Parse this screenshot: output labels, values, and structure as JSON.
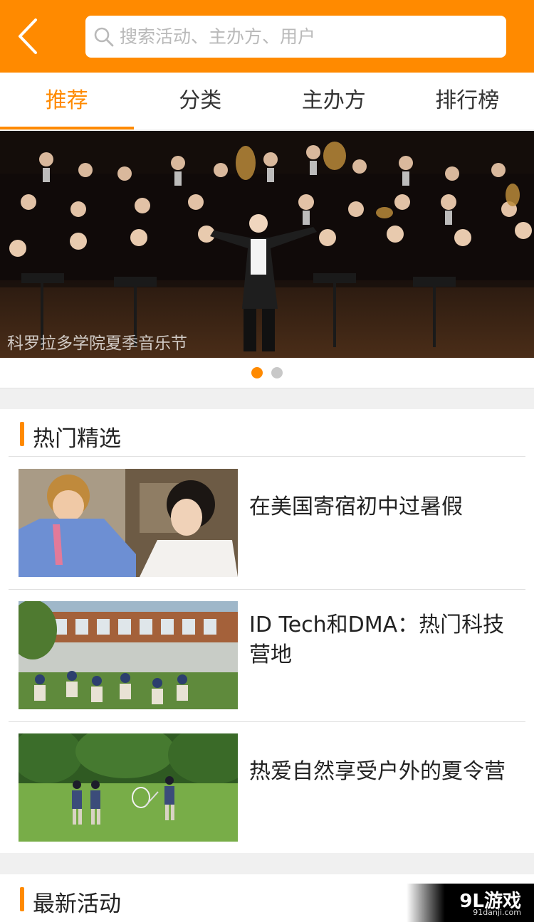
{
  "search": {
    "placeholder": "搜索活动、主办方、用户"
  },
  "tabs": [
    {
      "label": "推荐",
      "active": true
    },
    {
      "label": "分类",
      "active": false
    },
    {
      "label": "主办方",
      "active": false
    },
    {
      "label": "排行榜",
      "active": false
    }
  ],
  "banner": {
    "caption": "科罗拉多学院夏季音乐节",
    "slide_count": 2,
    "active_slide": 1
  },
  "hot": {
    "title": "热门精选",
    "items": [
      {
        "title": "在美国寄宿初中过暑假"
      },
      {
        "title": "ID Tech和DMA：热门科技营地"
      },
      {
        "title": "热爱自然享受户外的夏令营"
      }
    ]
  },
  "latest": {
    "title": "最新活动"
  },
  "watermark": {
    "logo": "9L游戏",
    "url": "91danji.com"
  },
  "colors": {
    "accent": "#ff8a00",
    "background": "#f0f0f0"
  }
}
